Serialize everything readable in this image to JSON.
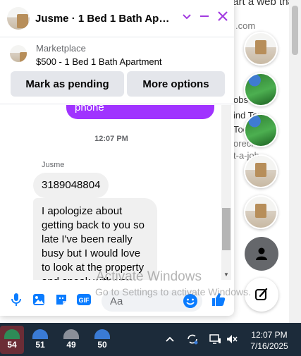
{
  "background_page": {
    "snippets": [
      "Start a web tha",
      ".com",
      "obs",
      "ind Top",
      "Toc",
      "orecl",
      "t-a-job"
    ]
  },
  "chat": {
    "title": "Jusme · 1 Bed 1 Bath Apart...",
    "marketplace": {
      "source_label": "Marketplace",
      "item_label": "$500 - 1 Bed 1 Bath Apartment",
      "mark_pending_label": "Mark as pending",
      "more_options_label": "More options"
    },
    "messages": {
      "outgoing_fragment": "phone",
      "timestamp": "12:07 PM",
      "sender_name": "Jusme",
      "incoming": [
        "3189048804",
        "I apologize about getting back to you so late I've been really busy but I would love to look at the property and speak with you"
      ]
    },
    "composer": {
      "placeholder": "Aa"
    }
  },
  "watermark": {
    "line1": "Activate Windows",
    "line2": "Go to Settings to activate Windows."
  },
  "taskbar": {
    "apps": [
      {
        "badge": "54",
        "active": true
      },
      {
        "badge": "51",
        "active": false
      },
      {
        "badge": "49",
        "active": false
      },
      {
        "badge": "50",
        "active": false
      }
    ],
    "clock_time": "12:07 PM",
    "clock_date": "7/16/2025"
  },
  "colors": {
    "accent": "#a033ff",
    "icon_purple": "#a33de0",
    "composer_blue": "#0a7cff",
    "taskbar": "#1c2b3a"
  }
}
